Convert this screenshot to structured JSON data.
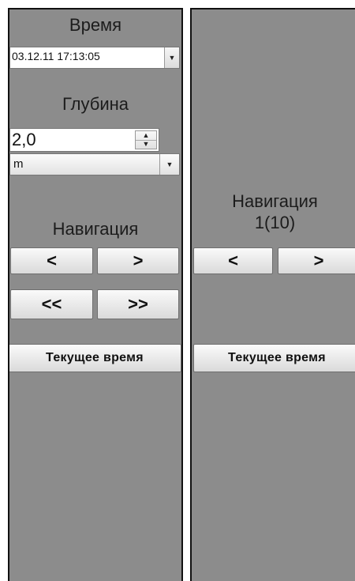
{
  "left_panel": {
    "time": {
      "label": "Время",
      "value": "03.12.11 17:13:05"
    },
    "depth": {
      "label": "Глубина",
      "value": "2,0",
      "units": "m"
    },
    "navigation": {
      "label": "Навигация",
      "prev_label": "<",
      "next_label": ">",
      "fast_prev_label": "<<",
      "fast_next_label": ">>"
    },
    "current_time_label": "Текущее время"
  },
  "right_panel": {
    "navigation": {
      "label": "Навигация",
      "page_info": "1(10)",
      "prev_label": "<",
      "next_label": ">"
    },
    "current_time_label": "Текущее время"
  },
  "icons": {
    "dropdown": "chevron-down-icon",
    "spin_up": "arrow-up-icon",
    "spin_down": "arrow-down-icon"
  },
  "colors": {
    "panel_background": "#8c8c8c",
    "panel_border": "#111111",
    "button_face": "#e6e6e6"
  }
}
